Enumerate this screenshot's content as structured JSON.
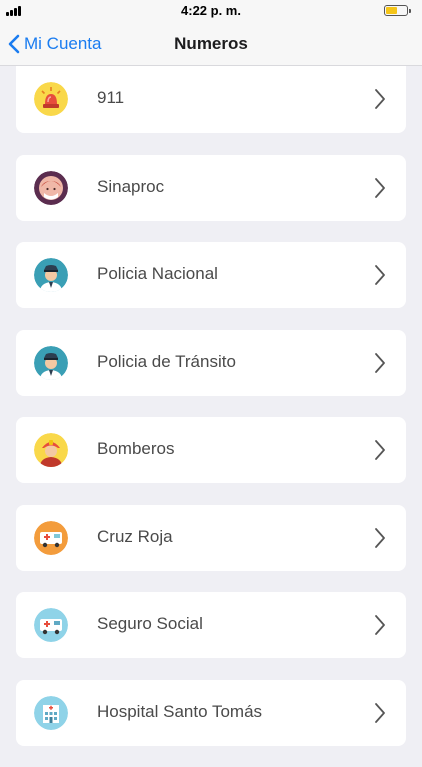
{
  "status": {
    "time": "4:22 p. m."
  },
  "nav": {
    "back_label": "Mi Cuenta",
    "title": "Numeros"
  },
  "items": [
    {
      "label": "911",
      "icon": "siren-icon"
    },
    {
      "label": "Sinaproc",
      "icon": "sinaproc-icon"
    },
    {
      "label": "Policia Nacional",
      "icon": "police-officer-icon"
    },
    {
      "label": "Policia de Tránsito",
      "icon": "traffic-officer-icon"
    },
    {
      "label": "Bomberos",
      "icon": "firefighter-icon"
    },
    {
      "label": "Cruz Roja",
      "icon": "ambulance-icon"
    },
    {
      "label": "Seguro Social",
      "icon": "medical-van-icon"
    },
    {
      "label": "Hospital Santo Tomás",
      "icon": "hospital-icon"
    }
  ],
  "colors": {
    "accent": "#1a7cf0",
    "background": "#efeff4"
  }
}
